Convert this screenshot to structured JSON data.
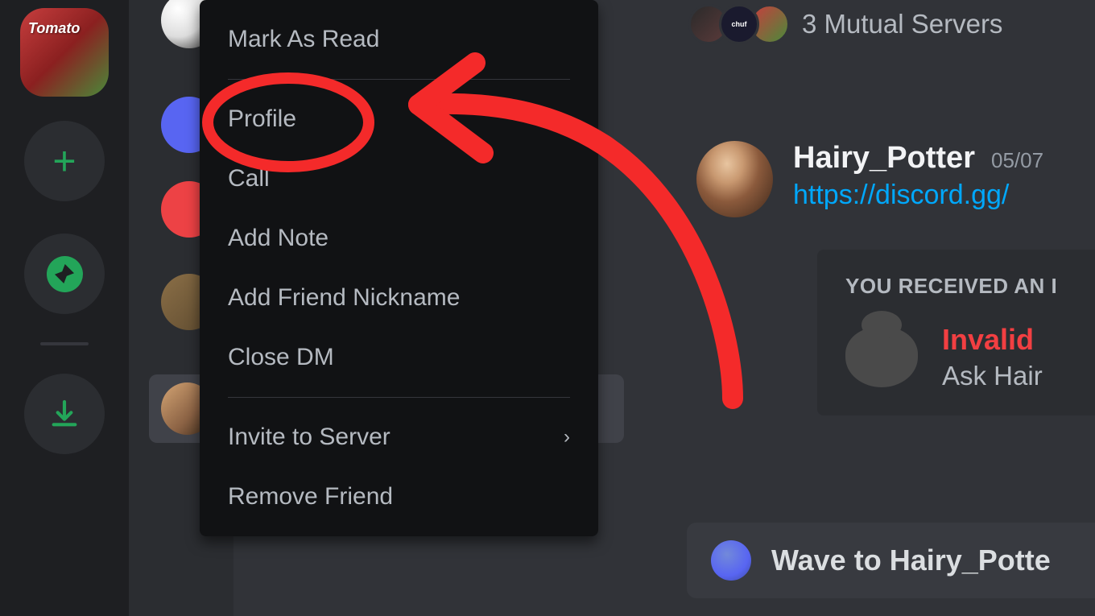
{
  "server_rail": {
    "server_avatar_label": "Tomato"
  },
  "context_menu": {
    "items": [
      "Mark As Read",
      "Profile",
      "Call",
      "Add Note",
      "Add Friend Nickname",
      "Close DM",
      "Invite to Server",
      "Remove Friend"
    ]
  },
  "mutual": {
    "text": "3 Mutual Servers"
  },
  "message": {
    "username": "Hairy_Potter",
    "timestamp": "05/07",
    "link": "https://discord.gg/"
  },
  "invite": {
    "header": "YOU RECEIVED AN I",
    "status": "Invalid",
    "sub": "Ask Hair"
  },
  "wave": {
    "text": "Wave to Hairy_Potte"
  },
  "annotation": {
    "highlighted_item": "Profile",
    "color": "#f42a2a"
  }
}
